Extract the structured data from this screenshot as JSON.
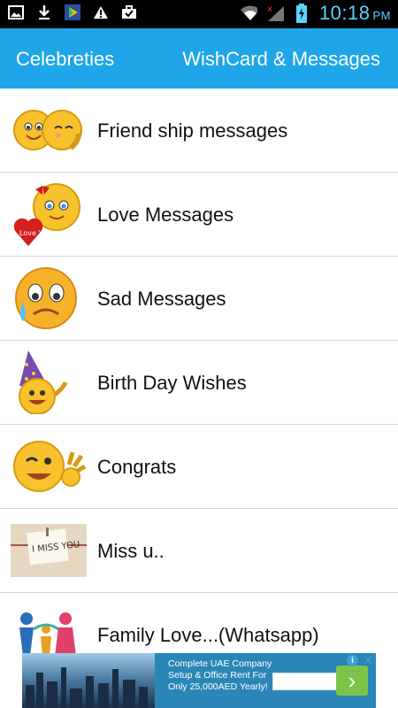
{
  "status_bar": {
    "time": "10:18",
    "ampm": "PM",
    "icons": [
      "image-icon",
      "download-icon",
      "play-store-icon",
      "warning-icon",
      "briefcase-icon",
      "wifi-icon",
      "signal-icon",
      "battery-icon"
    ]
  },
  "header": {
    "tab_left": "Celebreties",
    "tab_right": "WishCard & Messages"
  },
  "list": [
    {
      "label": "Friend ship messages",
      "icon": "friendship-emoji-icon"
    },
    {
      "label": "Love Messages",
      "icon": "love-emoji-icon"
    },
    {
      "label": "Sad Messages",
      "icon": "sad-emoji-icon"
    },
    {
      "label": "Birth Day Wishes",
      "icon": "birthday-emoji-icon"
    },
    {
      "label": "Congrats",
      "icon": "congrats-emoji-icon"
    },
    {
      "label": "Miss u..",
      "icon": "miss-you-note-icon"
    },
    {
      "label": "Family Love...(Whatsapp)",
      "icon": "family-icon"
    }
  ],
  "ad": {
    "text": "Complete UAE Company Setup & Office Rent For Only 25,000AED Yearly!"
  },
  "colors": {
    "header": "#1ea6e8",
    "status_bar": "#000000",
    "ad_bg": "#2b86b8"
  }
}
